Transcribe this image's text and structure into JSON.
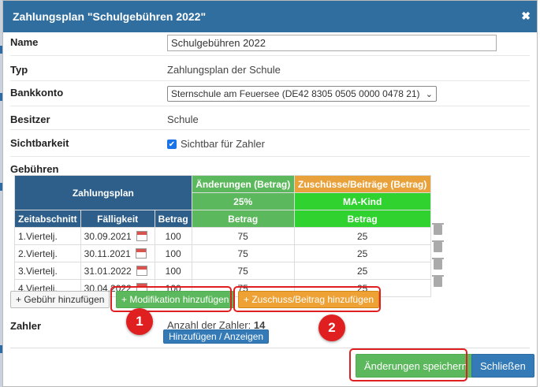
{
  "dialog": {
    "title": "Zahlungsplan \"Schulgebühren 2022\"",
    "close_icon": "close-icon"
  },
  "form": {
    "name_label": "Name",
    "name_value": "Schulgebühren 2022",
    "typ_label": "Typ",
    "typ_value": "Zahlungsplan der Schule",
    "bank_label": "Bankkonto",
    "bank_value": "Sternschule am Feuersee (DE42 8305 0505 0000 0478 21)",
    "owner_label": "Besitzer",
    "owner_value": "Schule",
    "visibility_label": "Sichtbarkeit",
    "visibility_checkbox_label": "Sichtbar für Zahler",
    "fees_label": "Gebühren"
  },
  "fees_table": {
    "group_plan": "Zahlungsplan",
    "group_changes": "Änderungen (Betrag)",
    "group_changes_sub": "25%",
    "group_grants": "Zuschüsse/Beiträge (Betrag)",
    "group_grants_sub": "MA-Kind",
    "col_period": "Zeitabschnitt",
    "col_due": "Fälligkeit",
    "col_amount": "Betrag",
    "col_changes_amount": "Betrag",
    "col_grants_amount": "Betrag",
    "rows": [
      {
        "period": "1.Viertelj.",
        "due": "30.09.2021",
        "amount": "100",
        "change": "75",
        "grant": "25"
      },
      {
        "period": "2.Viertelj.",
        "due": "30.11.2021",
        "amount": "100",
        "change": "75",
        "grant": "25"
      },
      {
        "period": "3.Viertelj.",
        "due": "31.01.2022",
        "amount": "100",
        "change": "75",
        "grant": "25"
      },
      {
        "period": "4.Viertelj.",
        "due": "30.04.2022",
        "amount": "100",
        "change": "75",
        "grant": "25"
      }
    ]
  },
  "buttons": {
    "add_fee": "+ Gebühr hinzufügen",
    "add_modification": "+ Modifikation hinzufügen",
    "add_grant": "+ Zuschuss/Beitrag hinzufügen",
    "add_view": "Hinzufügen / Anzeigen",
    "save": "Änderungen speichern",
    "close": "Schließen"
  },
  "payers": {
    "label": "Zahler",
    "count_label": "Anzahl der Zahler:",
    "count": "14"
  },
  "annotations": {
    "badge_1": "1",
    "badge_2": "2"
  },
  "colors": {
    "title_bar": "#2f6e9f",
    "header_blue": "#2e5f8a",
    "header_green": "#5cb85c",
    "header_orange": "#e9a23b",
    "header_lime": "#2fd22f",
    "highlight_red": "#e02020"
  }
}
